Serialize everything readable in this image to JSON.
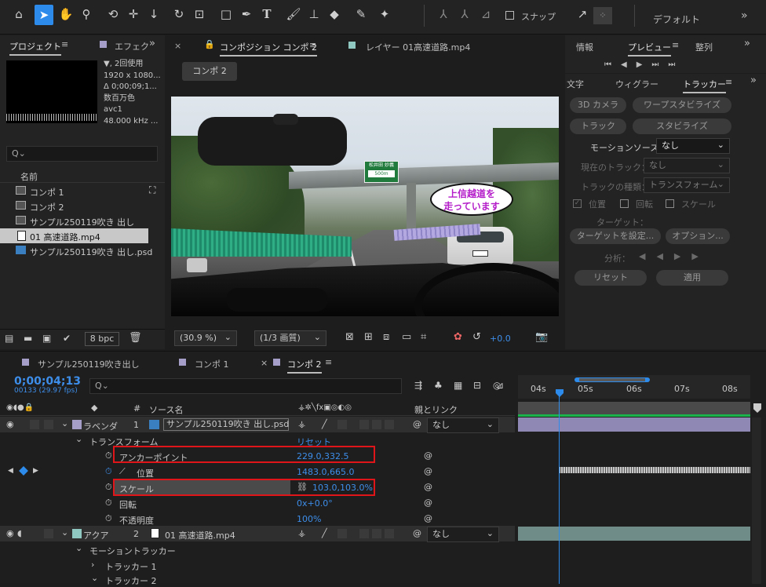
{
  "toolbar": {
    "snap_label": "スナップ",
    "workspace": "デフォルト"
  },
  "project": {
    "tab": "プロジェクト",
    "tab2": "エフェク",
    "info": [
      "▼, 2回使用",
      "1920 x 1080...",
      "Δ 0;00;09;1...",
      "数百万色",
      "avc1",
      "48.000 kHz ..."
    ],
    "search_placeholder": "Q⌄",
    "col_name": "名前",
    "items": [
      "コンポ 1",
      "コンポ 2",
      "サンプル250119吹き 出し",
      "01 高速道路.mp4",
      "サンプル250119吹き 出し.psd"
    ],
    "bpc": "8 bpc"
  },
  "comp_viewer": {
    "tab_comp": "コンポジション コンポ 2",
    "tab_layer": "レイヤー 01高速道路.mp4",
    "breadcrumb": "コンポ 2",
    "zoom": "(30.9 %)",
    "quality": "(1/3 画質)",
    "exposure": "+0.0",
    "bubble_line1": "上信越道を",
    "bubble_line2": "走っています",
    "sign_text": "松井田 妙義",
    "sign_dist": "500m"
  },
  "right_panel": {
    "tabs": [
      "情報",
      "プレビュー",
      "整列"
    ],
    "tabs2": [
      "文字",
      "ウィグラー",
      "トラッカー"
    ],
    "btn_3d": "3D カメラ",
    "btn_warp": "ワープスタビライズ",
    "btn_track": "トラック",
    "btn_stab": "スタビライズ",
    "motion_source_label": "モーションソース：",
    "motion_source_val": "なし",
    "current_track_label": "現在のトラック：",
    "current_track_val": "なし",
    "track_type_label": "トラックの種類：",
    "track_type_val": "トランスフォーム",
    "cb_position": "位置",
    "cb_rotation": "回転",
    "cb_scale": "スケール",
    "target_label": "ターゲット：",
    "btn_set_target": "ターゲットを設定...",
    "btn_options": "オプション...",
    "analyze_label": "分析：",
    "btn_reset": "リセット",
    "btn_apply": "適用"
  },
  "timeline": {
    "tabs": [
      "サンプル250119吹き出し",
      "コンポ 1",
      "コンポ 2"
    ],
    "timecode": "0;00;04;13",
    "frames": "00133 (29.97 fps)",
    "ruler": [
      "04s",
      "05s",
      "06s",
      "07s",
      "08s"
    ],
    "col_source": "ソース名",
    "col_parent": "親とリンク",
    "layer1": {
      "name": "ラベンダ",
      "num": "1",
      "source": "サンプル250119吹き 出し.psd",
      "parent": "なし"
    },
    "transform": "トランスフォーム",
    "reset": "リセット",
    "props": [
      {
        "name": "アンカーポイント",
        "value": "229.0,332.5"
      },
      {
        "name": "位置",
        "value": "1483.0,665.0"
      },
      {
        "name": "スケール",
        "value": "103.0,103.0%"
      },
      {
        "name": "回転",
        "value": "0x+0.0°"
      },
      {
        "name": "不透明度",
        "value": "100%"
      }
    ],
    "layer2": {
      "name": "アクア",
      "num": "2",
      "source": "01 高速道路.mp4",
      "parent": "なし"
    },
    "motion_tracker": "モーショントラッカー",
    "tracker1": "トラッカー 1",
    "tracker2": "トラッカー 2"
  },
  "colors": {
    "accent": "#2d8ceb",
    "lavender": "#a49ec8",
    "aqua": "#8ec8c0",
    "highlight_red": "#e0151a"
  }
}
